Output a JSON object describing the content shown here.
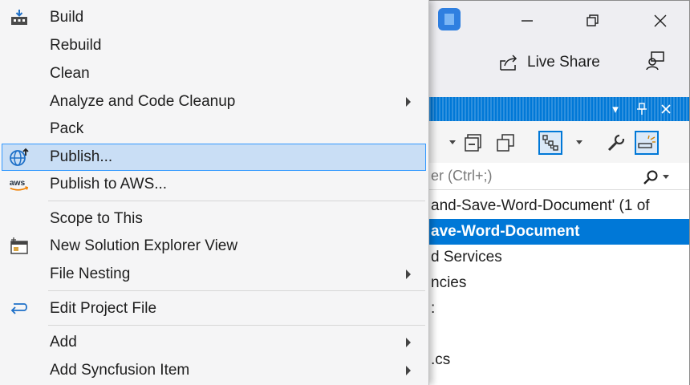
{
  "window": {
    "live_share_label": "Live Share"
  },
  "solution_explorer": {
    "search_placeholder": "er (Ctrl+;)",
    "tree": [
      {
        "label": "and-Save-Word-Document' (1 of"
      },
      {
        "label": "ave-Word-Document"
      },
      {
        "label": "d Services"
      },
      {
        "label": "ncies"
      },
      {
        "label": ":"
      },
      {
        "label": ""
      },
      {
        "label": ".cs"
      }
    ]
  },
  "context_menu": {
    "items": [
      {
        "label": "Build",
        "icon": "build-icon",
        "submenu": false
      },
      {
        "label": "Rebuild",
        "icon": "",
        "submenu": false
      },
      {
        "label": "Clean",
        "icon": "",
        "submenu": false
      },
      {
        "label": "Analyze and Code Cleanup",
        "icon": "",
        "submenu": true
      },
      {
        "label": "Pack",
        "icon": "",
        "submenu": false
      },
      {
        "label": "Publish...",
        "icon": "publish-globe-icon",
        "submenu": false,
        "highlighted": true
      },
      {
        "label": "Publish to AWS...",
        "icon": "aws-icon",
        "submenu": false
      },
      {
        "label": "Scope to This",
        "icon": "",
        "submenu": false
      },
      {
        "label": "New Solution Explorer View",
        "icon": "new-window-icon",
        "submenu": false
      },
      {
        "label": "File Nesting",
        "icon": "",
        "submenu": true
      },
      {
        "label": "Edit Project File",
        "icon": "edit-arrow-icon",
        "submenu": false
      },
      {
        "label": "Add",
        "icon": "",
        "submenu": true
      },
      {
        "label": "Add Syncfusion Item",
        "icon": "",
        "submenu": true
      }
    ],
    "aws_icon_text": "aws"
  },
  "colors": {
    "accent": "#0078d7",
    "highlight_bg": "#c9def5",
    "highlight_border": "#3399ff"
  }
}
